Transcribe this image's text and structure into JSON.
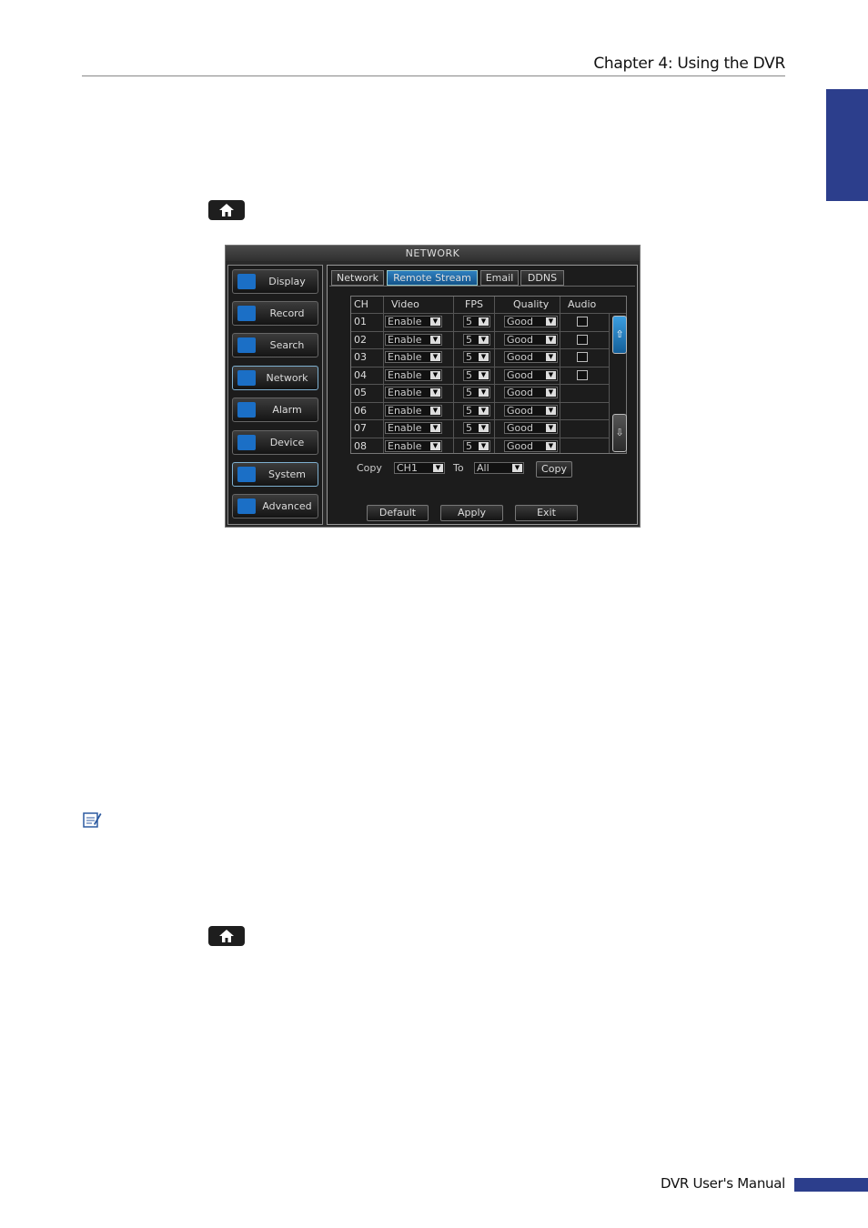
{
  "header": {
    "title": "Chapter 4: Using the DVR"
  },
  "footer": {
    "title": "DVR User's Manual"
  },
  "icons": {
    "home": "home-icon",
    "note": "note-icon"
  },
  "dvr": {
    "title": "NETWORK",
    "menu": [
      "Display",
      "Record",
      "Search",
      "Network",
      "Alarm",
      "Device",
      "System",
      "Advanced"
    ],
    "tabs": [
      "Network",
      "Remote Stream",
      "Email",
      "DDNS"
    ],
    "columns": [
      "CH",
      "Video",
      "FPS",
      "Quality",
      "Audio"
    ],
    "rows": [
      {
        "ch": "01",
        "video": "Enable",
        "fps": "5",
        "quality": "Good"
      },
      {
        "ch": "02",
        "video": "Enable",
        "fps": "5",
        "quality": "Good"
      },
      {
        "ch": "03",
        "video": "Enable",
        "fps": "5",
        "quality": "Good"
      },
      {
        "ch": "04",
        "video": "Enable",
        "fps": "5",
        "quality": "Good"
      },
      {
        "ch": "05",
        "video": "Enable",
        "fps": "5",
        "quality": "Good"
      },
      {
        "ch": "06",
        "video": "Enable",
        "fps": "5",
        "quality": "Good"
      },
      {
        "ch": "07",
        "video": "Enable",
        "fps": "5",
        "quality": "Good"
      },
      {
        "ch": "08",
        "video": "Enable",
        "fps": "5",
        "quality": "Good"
      }
    ],
    "copy": {
      "label": "Copy",
      "from": "CH1",
      "to_label": "To",
      "to": "All",
      "button": "Copy"
    },
    "buttons": {
      "default": "Default",
      "apply": "Apply",
      "exit": "Exit"
    },
    "colors": {
      "accent": "#2c3e8c",
      "highlight": "#1b6fc6"
    }
  }
}
